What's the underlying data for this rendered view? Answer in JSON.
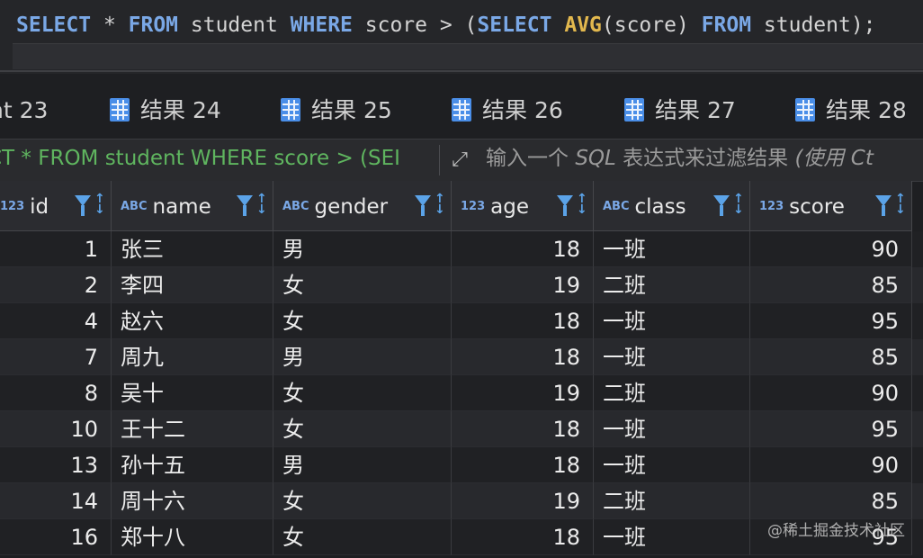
{
  "editor": {
    "sql": [
      {
        "t": "SELECT",
        "c": "kw"
      },
      {
        "t": " * ",
        "c": ""
      },
      {
        "t": "FROM",
        "c": "kw"
      },
      {
        "t": " student ",
        "c": ""
      },
      {
        "t": "WHERE",
        "c": "kw"
      },
      {
        "t": " score > (",
        "c": ""
      },
      {
        "t": "SELECT",
        "c": "kw"
      },
      {
        "t": " ",
        "c": ""
      },
      {
        "t": "AVG",
        "c": "fn"
      },
      {
        "t": "(score) ",
        "c": ""
      },
      {
        "t": "FROM",
        "c": "kw"
      },
      {
        "t": " student);",
        "c": ""
      }
    ]
  },
  "tabs": [
    {
      "label": "nt 23",
      "icon": false
    },
    {
      "label": "结果 24",
      "icon": true
    },
    {
      "label": "结果 25",
      "icon": true
    },
    {
      "label": "结果 26",
      "icon": true
    },
    {
      "label": "结果 27",
      "icon": true
    },
    {
      "label": "结果 28",
      "icon": true
    }
  ],
  "filter": {
    "query": "CT * FROM student WHERE score > (SEI",
    "placeholder_a": "输入一个 ",
    "placeholder_b": "SQL",
    "placeholder_c": " 表达式来过滤结果 ",
    "placeholder_d": "(使用 Ct"
  },
  "columns": [
    {
      "type": "123",
      "name": "id",
      "align": "num"
    },
    {
      "type": "ABC",
      "name": "name",
      "align": "txt"
    },
    {
      "type": "ABC",
      "name": "gender",
      "align": "txt"
    },
    {
      "type": "123",
      "name": "age",
      "align": "num"
    },
    {
      "type": "ABC",
      "name": "class",
      "align": "txt"
    },
    {
      "type": "123",
      "name": "score",
      "align": "num"
    }
  ],
  "rows": [
    [
      "1",
      "张三",
      "男",
      "18",
      "一班",
      "90"
    ],
    [
      "2",
      "李四",
      "女",
      "19",
      "二班",
      "85"
    ],
    [
      "4",
      "赵六",
      "女",
      "18",
      "一班",
      "95"
    ],
    [
      "7",
      "周九",
      "男",
      "18",
      "一班",
      "85"
    ],
    [
      "8",
      "吴十",
      "女",
      "19",
      "二班",
      "90"
    ],
    [
      "10",
      "王十二",
      "女",
      "18",
      "一班",
      "95"
    ],
    [
      "13",
      "孙十五",
      "男",
      "18",
      "一班",
      "90"
    ],
    [
      "14",
      "周十六",
      "女",
      "19",
      "二班",
      "85"
    ],
    [
      "16",
      "郑十八",
      "女",
      "18",
      "一班",
      "95"
    ]
  ],
  "watermark": "@稀土掘金技术社区",
  "colors": {
    "keyword": "#7aa8e6",
    "function": "#e2b84e",
    "filter_text": "#5fb55f",
    "accent": "#5ba3e8"
  }
}
